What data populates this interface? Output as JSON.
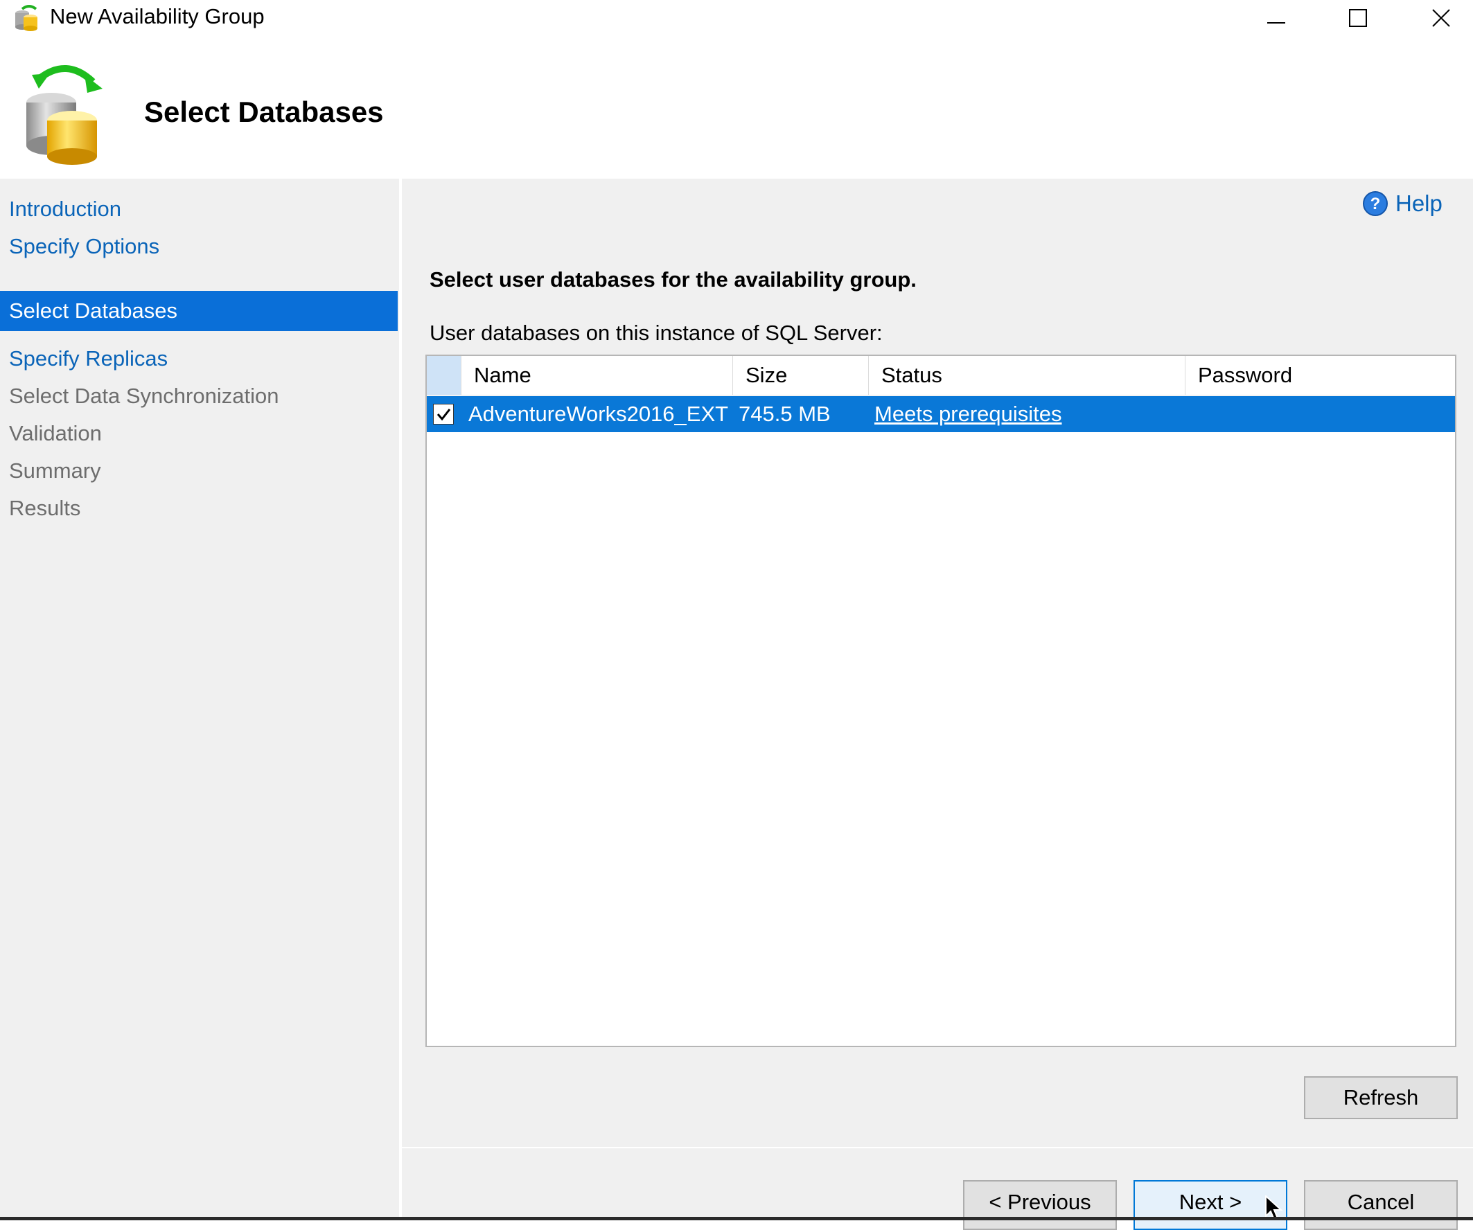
{
  "window": {
    "title": "New Availability Group",
    "controls": [
      "minimize-icon",
      "maximize-icon",
      "close-icon"
    ]
  },
  "header": {
    "heading": "Select Databases",
    "icon": "database-sync-icon"
  },
  "nav": {
    "items": [
      {
        "label": "Introduction",
        "state": "link"
      },
      {
        "label": "Specify Options",
        "state": "link"
      },
      {
        "label": "Select Databases",
        "state": "active"
      },
      {
        "label": "Specify Replicas",
        "state": "link"
      },
      {
        "label": "Select Data Synchronization",
        "state": "disabled"
      },
      {
        "label": "Validation",
        "state": "disabled"
      },
      {
        "label": "Summary",
        "state": "disabled"
      },
      {
        "label": "Results",
        "state": "disabled"
      }
    ]
  },
  "help": {
    "label": "Help",
    "icon": "help-icon"
  },
  "main": {
    "instruction": "Select user databases for the availability group.",
    "grid_label": "User databases on this instance of SQL Server:",
    "columns": [
      "Name",
      "Size",
      "Status",
      "Password"
    ],
    "rows": [
      {
        "checked": true,
        "name": "AdventureWorks2016_EXT",
        "size": "745.5 MB",
        "status": "Meets prerequisites",
        "password": ""
      }
    ]
  },
  "buttons": {
    "refresh": "Refresh",
    "previous": "< Previous",
    "next": "Next >",
    "cancel": "Cancel"
  },
  "colors": {
    "accent": "#0a78d7",
    "link": "#0a64b8",
    "panel": "#f0f0f0"
  }
}
